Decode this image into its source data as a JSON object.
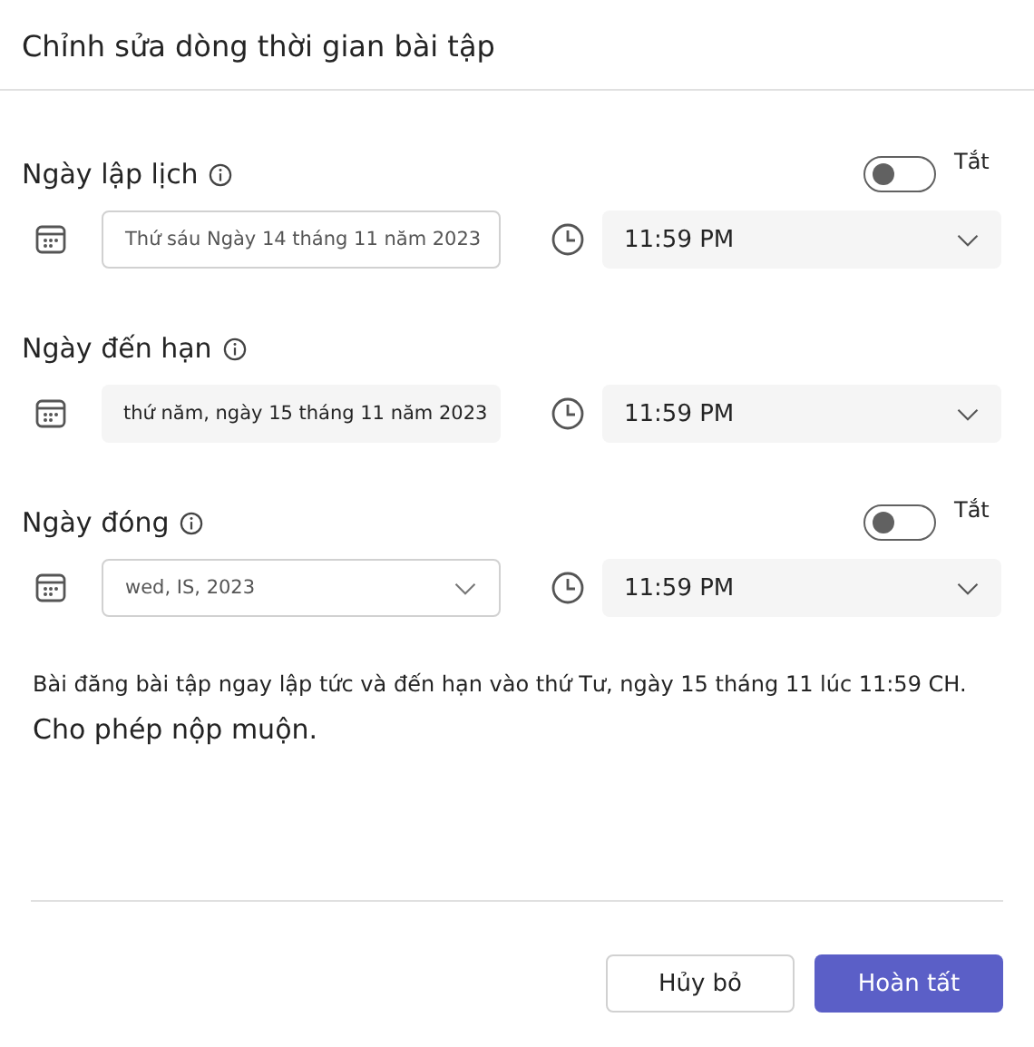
{
  "dialog": {
    "title": "Chỉnh sửa dòng thời gian bài tập"
  },
  "sections": [
    {
      "label": "Ngày lập lịch",
      "toggle": {
        "on": false,
        "label": "Tắt"
      },
      "date": {
        "value": "Thứ sáu Ngày 14 tháng 11 năm 2023",
        "disabled": true
      },
      "time": {
        "value": "11:59 PM",
        "disabled": false
      }
    },
    {
      "label": "Ngày đến hạn",
      "date": {
        "value": "thứ năm, ngày 15 tháng 11 năm 2023",
        "disabled": false
      },
      "time": {
        "value": "11:59 PM",
        "disabled": false
      }
    },
    {
      "label": "Ngày đóng",
      "toggle": {
        "on": false,
        "label": "Tắt"
      },
      "date": {
        "value": "wed, IS, 2023",
        "disabled": true
      },
      "time": {
        "value": "11:59 PM",
        "disabled": false
      }
    }
  ],
  "summary": "Bài đăng bài tập ngay lập tức và đến hạn vào thứ Tư, ngày 15 tháng 11 lúc 11:59 CH.",
  "late_submission": "Cho phép nộp muộn.",
  "buttons": {
    "cancel": "Hủy bỏ",
    "done": "Hoàn tất"
  }
}
